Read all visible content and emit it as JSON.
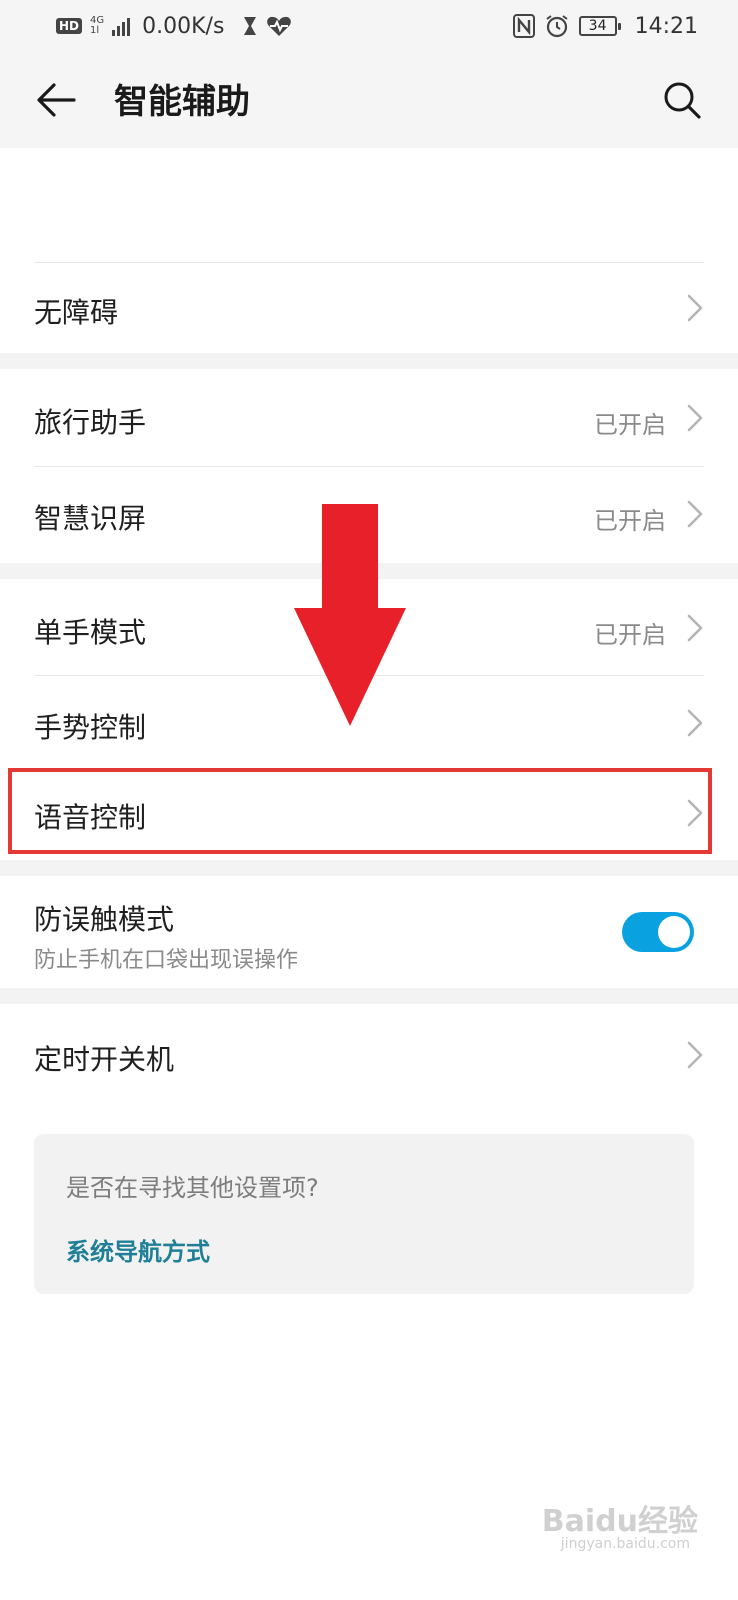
{
  "status_bar": {
    "hd": "HD",
    "net_top": "4G",
    "net_bottom": "1l",
    "speed": "0.00K/s",
    "battery": "34",
    "time": "14:21"
  },
  "header": {
    "title": "智能辅助"
  },
  "rows": [
    {
      "label": "无障碍",
      "status": ""
    },
    {
      "label": "旅行助手",
      "status": "已开启"
    },
    {
      "label": "智慧识屏",
      "status": "已开启"
    },
    {
      "label": "单手模式",
      "status": "已开启"
    },
    {
      "label": "手势控制",
      "status": ""
    },
    {
      "label": "语音控制",
      "status": ""
    }
  ],
  "toggle_row": {
    "label": "防误触模式",
    "subtitle": "防止手机在口袋出现误操作",
    "enabled": true
  },
  "timer_row": {
    "label": "定时开关机"
  },
  "suggestion": {
    "question": "是否在寻找其他设置项?",
    "link": "系统导航方式"
  },
  "watermark": {
    "text": "Baidu经验",
    "sub": "jingyan.baidu.com"
  },
  "colors": {
    "accent": "#0aa1e0",
    "highlight": "#e53935",
    "arrow": "#e8202a",
    "link": "#1e7f96"
  }
}
